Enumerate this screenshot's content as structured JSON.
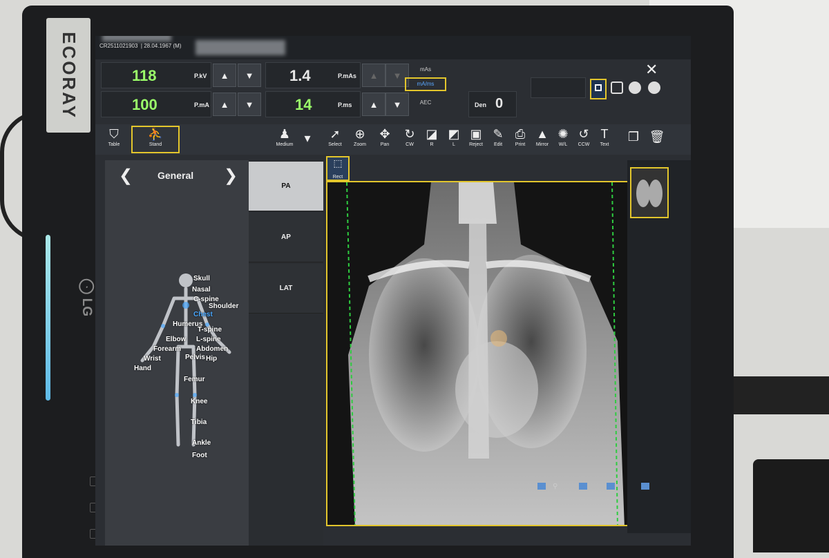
{
  "monitor": {
    "brand": "ECORAY",
    "maker": "LG"
  },
  "patient": {
    "id": "CR2511021903",
    "dob": "28.04.1967",
    "sex": "(M)"
  },
  "exposure": {
    "kv_value": "118",
    "kv_unit": "P.kV",
    "ma_value": "100",
    "ma_unit": "P.mA",
    "mas_value": "1.4",
    "mas_unit": "P.mAs",
    "ms_value": "14",
    "ms_unit": "P.ms",
    "mode_options": [
      "mAs",
      "mA/ms",
      "AEC"
    ],
    "mode_selected": "mA/ms",
    "density_label": "Den",
    "density_value": "0"
  },
  "positioning": {
    "table_label": "Table",
    "stand_label": "Stand",
    "size_label": "Medium"
  },
  "toolbar": {
    "tools": [
      "Select",
      "Zoom",
      "Pan",
      "CW",
      "R",
      "L",
      "Reject",
      "Edit",
      "Print",
      "Mirror",
      "W/L",
      "CCW",
      "Text"
    ]
  },
  "roi": {
    "shape_label": "Rect"
  },
  "anatomy": {
    "category": "General",
    "parts": [
      "Skull",
      "Nasal",
      "C-spine",
      "Shoulder",
      "Chest",
      "Humerus",
      "T-spine",
      "Elbow",
      "L-spine",
      "Forearm",
      "Abdomen",
      "Pelvis",
      "Hip",
      "Wrist",
      "Hand",
      "Femur",
      "Knee",
      "Tibia",
      "Ankle",
      "Foot"
    ],
    "selected": "Chest"
  },
  "views": [
    "PA",
    "AP",
    "LAT"
  ],
  "views_selected": "PA",
  "icons": [
    "close-icon",
    "table-icon",
    "stand-icon",
    "person-icon",
    "arrow-up-icon",
    "arrow-down-icon",
    "chevron-left-icon",
    "chevron-right-icon",
    "rect-roi-icon"
  ],
  "colors": {
    "accent_yellow": "#e3c62c",
    "value_green": "#9bff6a",
    "selected_blue": "#4aa8ff",
    "collimation_green": "#2ecc40"
  }
}
